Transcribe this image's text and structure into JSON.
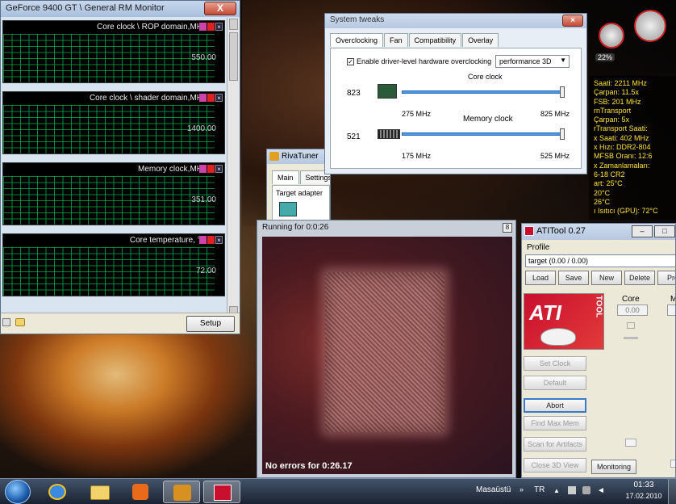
{
  "gpu_monitor": {
    "title": "GeForce 9400 GT \\ General RM Monitor",
    "close": "X",
    "graphs": [
      {
        "title": "Core clock \\ ROP domain,MHz",
        "value": "550.00"
      },
      {
        "title": "Core clock \\ shader domain,MHz",
        "value": "1400.00"
      },
      {
        "title": "Memory clock,MHz",
        "value": "351.00"
      },
      {
        "title": "Core temperature, °C",
        "value": "72.00"
      }
    ],
    "setup": "Setup"
  },
  "tweaks": {
    "title": "System tweaks",
    "tabs": [
      "Overclocking",
      "Fan",
      "Compatibility",
      "Overlay"
    ],
    "enable_label": "Enable driver-level hardware overclocking",
    "profile": "performance 3D",
    "core": {
      "label": "Core clock",
      "value": "823",
      "min": "275 MHz",
      "max": "825 MHz"
    },
    "memory": {
      "label": "Memory clock",
      "value": "521",
      "min": "175 MHz",
      "max": "525 MHz"
    }
  },
  "riva": {
    "title": "RivaTuner",
    "tabs": [
      "Main",
      "Settings"
    ],
    "target": "Target adapter"
  },
  "fur": {
    "title": "Running for 0:0:26",
    "status": "No errors for 0:26.17",
    "max_btn": "8"
  },
  "atitool": {
    "title": "ATITool 0.27",
    "profile_label": "Profile",
    "profile_value": "target (0.00 / 0.00)",
    "buttons": [
      "Load",
      "Save",
      "New",
      "Delete",
      "Pro"
    ],
    "core_label": "Core",
    "core_value": "0.00",
    "mem_label": "M",
    "logo": "ATI",
    "logo_sub": "TOOL",
    "actions": [
      "Set Clock",
      "Default",
      "Abort",
      "Find Max Mem",
      "Scan for Artifacts",
      "Close 3D View",
      "Monitoring"
    ]
  },
  "sidebar": {
    "lines": [
      "Saati: 2211 MHz",
      "Çarpan: 11.5x",
      "FSB: 201 MHz",
      "rnTransport",
      "Çarpan: 5x",
      "rTransport Saati:",
      "x Saati: 402 MHz",
      "x Hızı: DDR2-804",
      "MFSB Oranı: 12:6",
      "x Zamanlamaları:",
      "6-18 CR2",
      "art: 25°C",
      " 20°C",
      " 26°C",
      "ı Isıtıcı (GPU): 72°C"
    ],
    "gauge": "22%"
  },
  "taskbar": {
    "lang": "TR",
    "layout_label": "Masaüstü",
    "time": "01:33",
    "date": "17.02.2010"
  }
}
